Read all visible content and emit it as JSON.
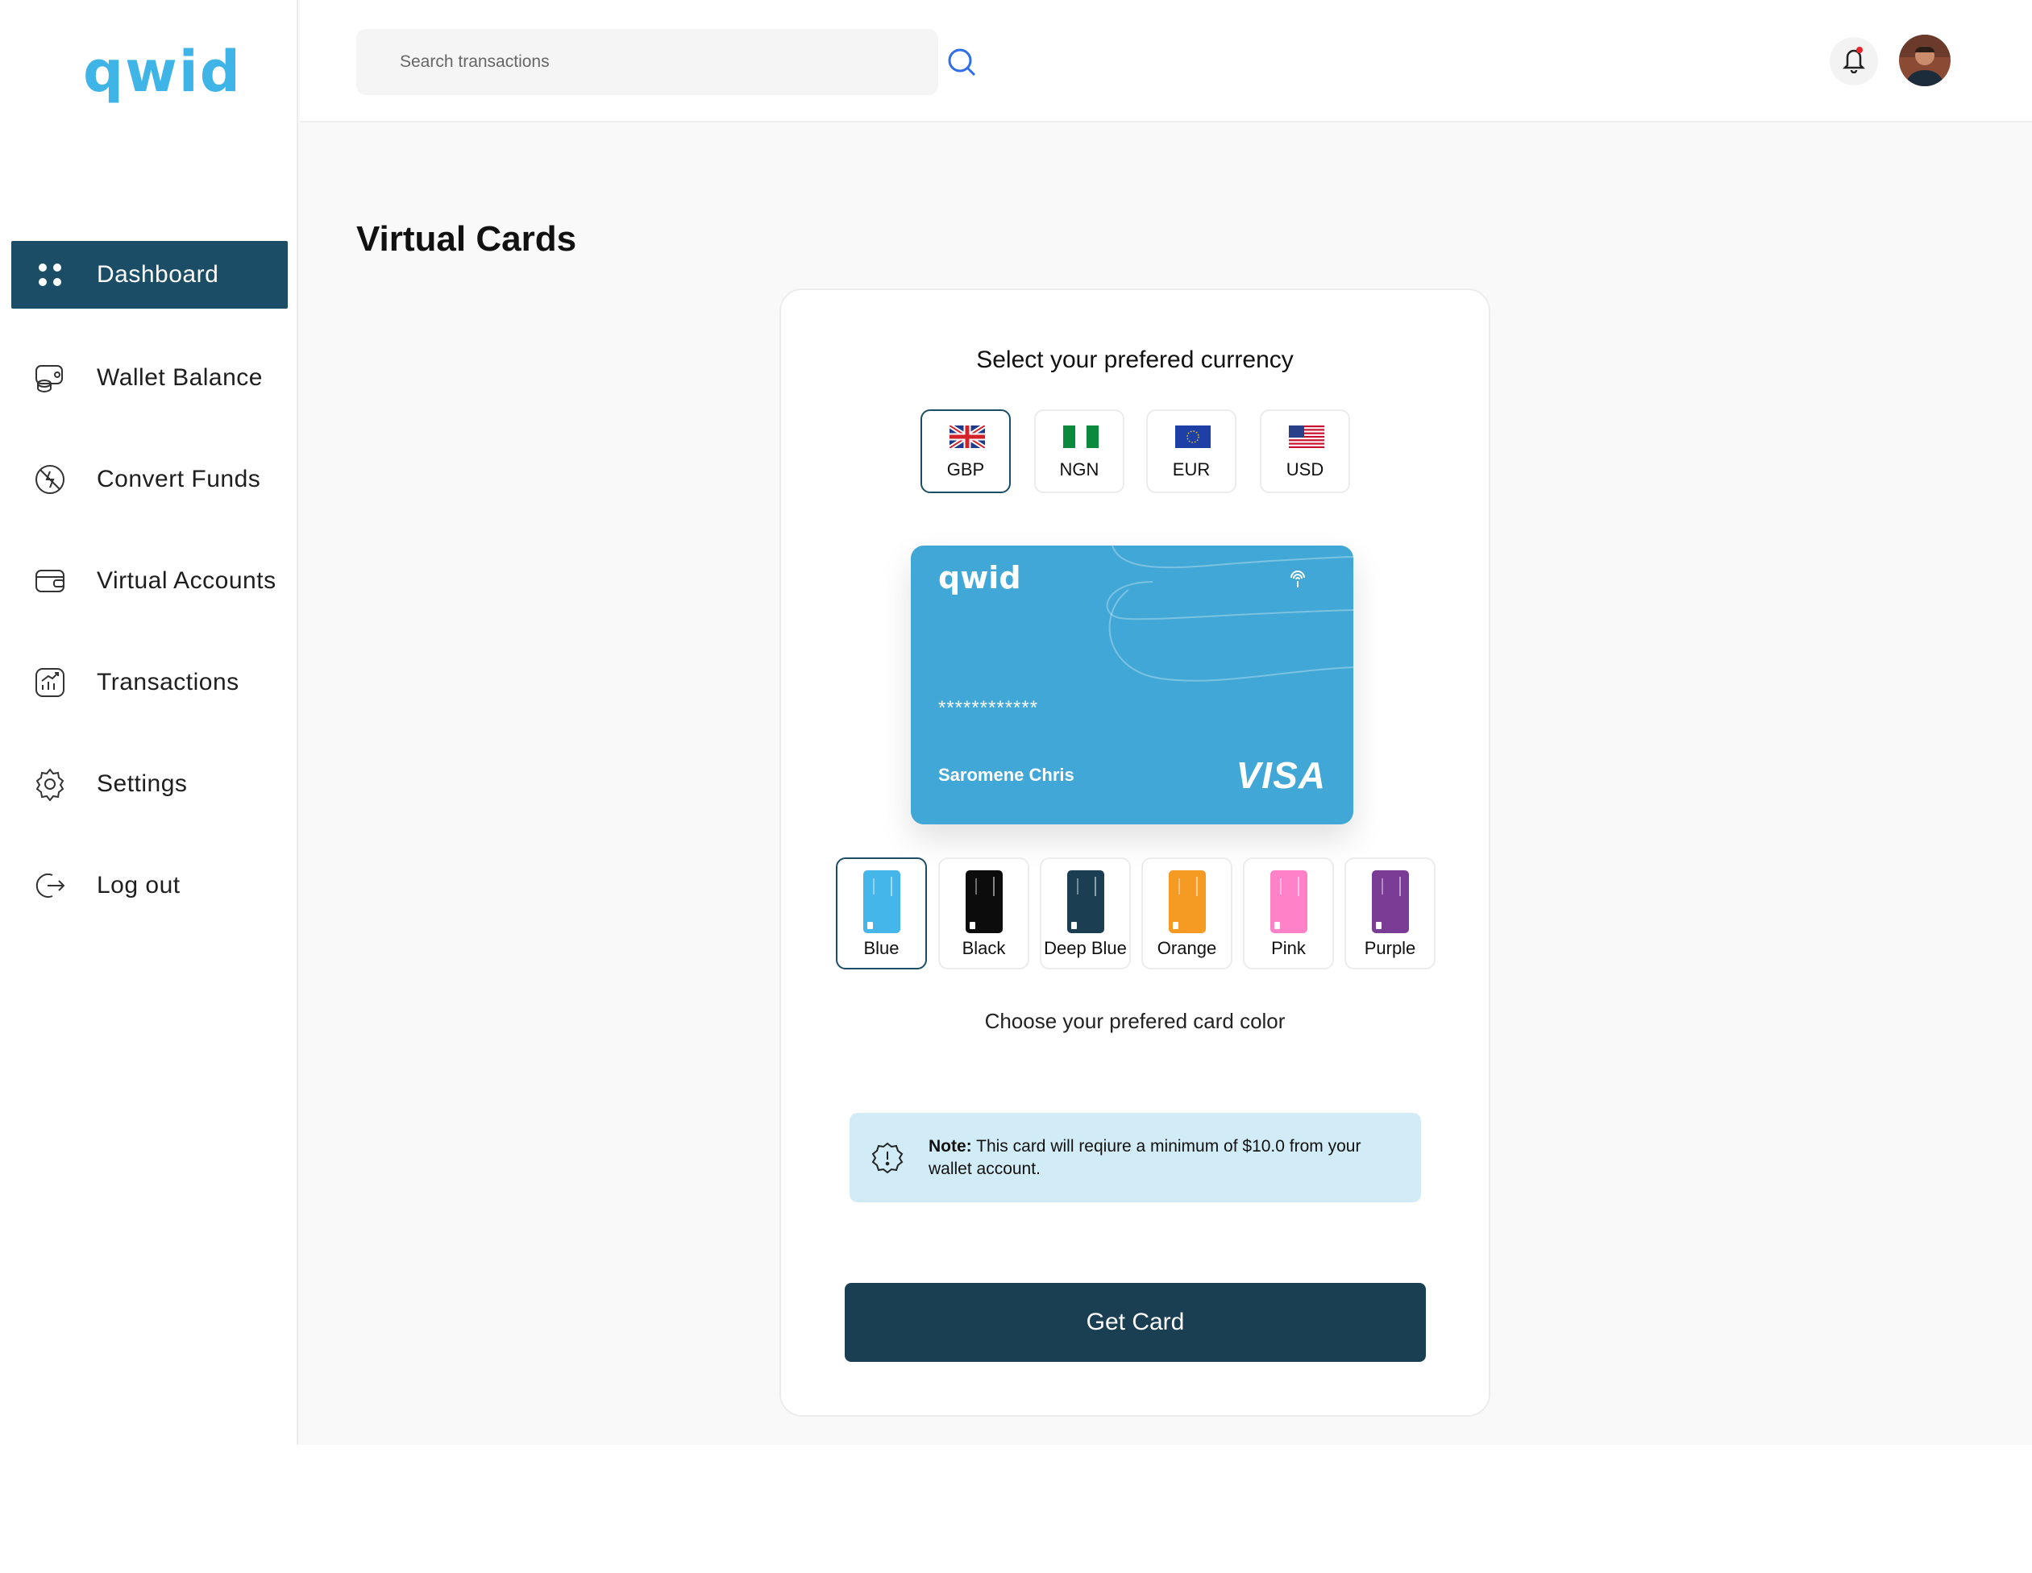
{
  "brand": {
    "logo_text": "qwid",
    "color": "#3fb4e6"
  },
  "sidebar": {
    "active_color": "#1b4e66",
    "items": [
      {
        "label": "Dashboard",
        "icon": "dashboard-grid-icon",
        "active": true
      },
      {
        "label": "Wallet Balance",
        "icon": "wallet-coins-icon",
        "active": false
      },
      {
        "label": "Convert Funds",
        "icon": "convert-funds-icon",
        "active": false
      },
      {
        "label": "Virtual Accounts",
        "icon": "virtual-account-icon",
        "active": false
      },
      {
        "label": "Transactions",
        "icon": "transactions-chart-icon",
        "active": false
      },
      {
        "label": "Settings",
        "icon": "gear-icon",
        "active": false
      },
      {
        "label": "Log out",
        "icon": "logout-icon",
        "active": false
      }
    ]
  },
  "header": {
    "search": {
      "placeholder": "Search transactions",
      "value": "",
      "icon": "search-icon"
    },
    "notification_icon": "bell-icon",
    "avatar": "user-avatar"
  },
  "main": {
    "title": "Virtual Cards",
    "currency_prompt": "Select your prefered currency",
    "currencies": [
      {
        "code": "GBP",
        "flag": "uk-flag-icon",
        "selected": true
      },
      {
        "code": "NGN",
        "flag": "nigeria-flag-icon",
        "selected": false
      },
      {
        "code": "EUR",
        "flag": "eu-flag-icon",
        "selected": false
      },
      {
        "code": "USD",
        "flag": "us-flag-icon",
        "selected": false
      }
    ],
    "card": {
      "brand": "qwid",
      "number": "************",
      "holder": "Saromene Chris",
      "network": "VISA",
      "color": "#41a7d6"
    },
    "card_colors": [
      {
        "label": "Blue",
        "hex": "#45b6ea",
        "selected": true
      },
      {
        "label": "Black",
        "hex": "#0c0c0c",
        "selected": false
      },
      {
        "label": "Deep Blue",
        "hex": "#1c3e52",
        "selected": false
      },
      {
        "label": "Orange",
        "hex": "#f59a23",
        "selected": false
      },
      {
        "label": "Pink",
        "hex": "#ff82c8",
        "selected": false
      },
      {
        "label": "Purple",
        "hex": "#7a3c95",
        "selected": false
      }
    ],
    "color_caption": "Choose your prefered card color",
    "note": {
      "label": "Note:",
      "text": " This card will reqiure a minimum of $10.0 from your wallet account.",
      "icon": "alert-badge-icon"
    },
    "cta_label": "Get Card"
  }
}
